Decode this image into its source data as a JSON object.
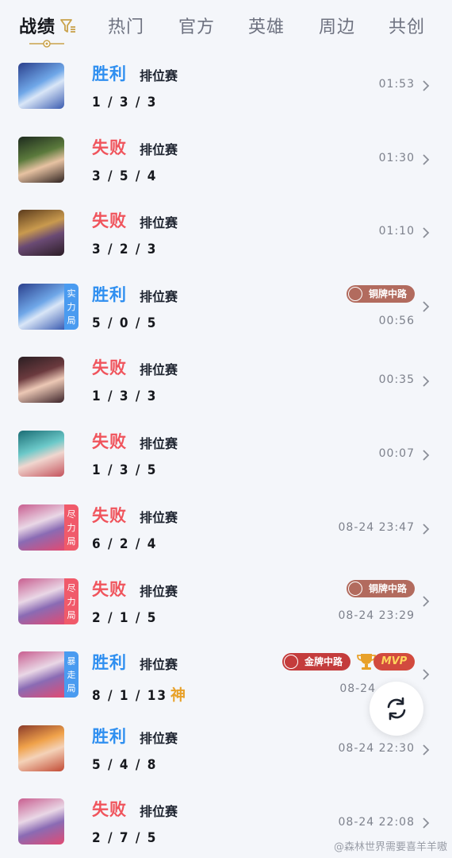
{
  "tabs": [
    {
      "label": "战绩",
      "active": true
    },
    {
      "label": "热门"
    },
    {
      "label": "官方"
    },
    {
      "label": "英雄"
    },
    {
      "label": "周边"
    },
    {
      "label": "共创"
    }
  ],
  "colors": {
    "win": "#2f8ff0",
    "loss": "#f0545c",
    "bronze_badge": "#b26b5e",
    "gold_badge": "#c43c3c"
  },
  "matches": [
    {
      "result": "胜利",
      "mode": "排位赛",
      "kda": "1 / 3 / 3",
      "time": "01:53"
    },
    {
      "result": "失败",
      "mode": "排位赛",
      "kda": "3 / 5 / 4",
      "time": "01:30"
    },
    {
      "result": "失败",
      "mode": "排位赛",
      "kda": "3 / 2 / 3",
      "time": "01:10"
    },
    {
      "result": "胜利",
      "mode": "排位赛",
      "kda": "5 / 0 / 5",
      "time": "00:56",
      "tag": "实力局",
      "badge": "铜牌中路"
    },
    {
      "result": "失败",
      "mode": "排位赛",
      "kda": "1 / 3 / 3",
      "time": "00:35"
    },
    {
      "result": "失败",
      "mode": "排位赛",
      "kda": "1 / 3 / 5",
      "time": "00:07"
    },
    {
      "result": "失败",
      "mode": "排位赛",
      "kda": "6 / 2 / 4",
      "time": "08-24 23:47",
      "tag": "尽力局"
    },
    {
      "result": "失败",
      "mode": "排位赛",
      "kda": "2 / 1 / 5",
      "time": "08-24 23:29",
      "tag": "尽力局",
      "badge": "铜牌中路"
    },
    {
      "result": "胜利",
      "mode": "排位赛",
      "kda": "8 / 1 / 13",
      "kda_extra": "神",
      "time": "08-24",
      "tag": "暴走局",
      "badge": "金牌中路",
      "mvp": "MVP"
    },
    {
      "result": "胜利",
      "mode": "排位赛",
      "kda": "5 / 4 / 8",
      "time": "08-24 22:30"
    },
    {
      "result": "失败",
      "mode": "排位赛",
      "kda": "2 / 7 / 5",
      "time": "08-24 22:08"
    }
  ],
  "watermark": "@森林世界需要喜羊羊嗷"
}
